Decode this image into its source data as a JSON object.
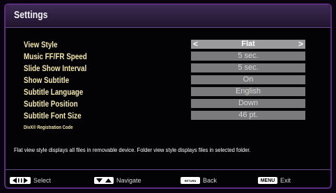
{
  "window": {
    "title": "Settings"
  },
  "settings": [
    {
      "label": "View Style",
      "value": "Flat",
      "selected": true
    },
    {
      "label": "Music FF/FR Speed",
      "value": "5 sec."
    },
    {
      "label": "Slide Show Interval",
      "value": "5 sec."
    },
    {
      "label": "Show Subtitle",
      "value": "On"
    },
    {
      "label": "Subtitle Language",
      "value": "English"
    },
    {
      "label": "Subtitle Position",
      "value": "Down"
    },
    {
      "label": "Subtitle Font Size",
      "value": "46 pt."
    }
  ],
  "registration_code_label": "DivX® Registration Code",
  "description": "Flat view style displays all files in removable device. Folder view style displays files in selected folder.",
  "arrows": {
    "left": "<",
    "right": ">"
  },
  "footer": {
    "select": {
      "label": "Select",
      "icon": "left-right-arrows-icon"
    },
    "navigate": {
      "label": "Navigate",
      "icon": "up-down-arrows-icon"
    },
    "back": {
      "label": "Back",
      "key": "RETURN",
      "icon": "return-key-icon"
    },
    "exit": {
      "label": "Exit",
      "key": "MENU",
      "icon": "menu-key-icon"
    }
  },
  "colors": {
    "frame_border": "#5a2f80",
    "label_text": "#f4e9a6",
    "value_box": "#7a7a7c",
    "selected_value_box": "#9a9a9c"
  }
}
